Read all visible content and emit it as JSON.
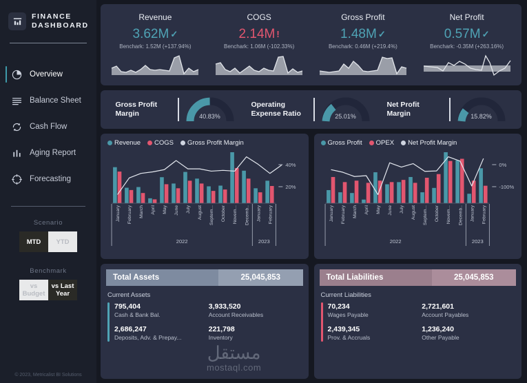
{
  "brand": {
    "line1": "FINANCE",
    "line2": "DASHBOARD",
    "logo_icon": "bar-chart-icon"
  },
  "sidebar": {
    "items": [
      {
        "label": "Overview",
        "icon": "pie-chart-icon",
        "active": true
      },
      {
        "label": "Balance Sheet",
        "icon": "list-lines-icon",
        "active": false
      },
      {
        "label": "Cash Flow",
        "icon": "refresh-icon",
        "active": false
      },
      {
        "label": "Aging Report",
        "icon": "bar-chart-icon",
        "active": false
      },
      {
        "label": "Forecasting",
        "icon": "target-icon",
        "active": false
      }
    ],
    "scenario": {
      "label": "Scenario",
      "options": [
        "MTD",
        "YTD"
      ],
      "selected": "MTD"
    },
    "benchmark": {
      "label": "Benchmark",
      "options": [
        "vs Budget",
        "vs Last Year"
      ],
      "selected": "vs Last Year"
    },
    "copyright": "© 2023, Metricalist BI Solutions"
  },
  "kpis": [
    {
      "title": "Revenue",
      "value": "3.62M",
      "flag": "✓",
      "color": "teal",
      "benchmark": "Benchark: 1.52M (+137.94%)"
    },
    {
      "title": "COGS",
      "value": "2.14M",
      "flag": "!",
      "color": "pink",
      "benchmark": "Benchark: 1.06M (-102.33%)"
    },
    {
      "title": "Gross Profit",
      "value": "1.48M",
      "flag": "✓",
      "color": "teal",
      "benchmark": "Benchark: 0.46M (+219.4%)"
    },
    {
      "title": "Net Profit",
      "value": "0.57M",
      "flag": "✓",
      "color": "teal",
      "benchmark": "Benchark: -0.35M (+263.16%)"
    }
  ],
  "gauges": [
    {
      "name": "Gross Profit Margin",
      "value": "40.83%",
      "pct": 40.83
    },
    {
      "name": "Operating Expense Ratio",
      "value": "25.01%",
      "pct": 25.01
    },
    {
      "name": "Net Profit Margin",
      "value": "15.82%",
      "pct": 15.82
    }
  ],
  "colors": {
    "teal": "#4a98a8",
    "pink": "#e2566f",
    "line": "#e4e8ef",
    "panel": "#2b3044"
  },
  "chart_data": [
    {
      "type": "bar",
      "title": "",
      "categories": [
        "January",
        "February",
        "March",
        "April",
        "May",
        "June",
        "July",
        "August",
        "Septem...",
        "October",
        "Novem...",
        "Decemb..",
        "January",
        "February"
      ],
      "group_labels": [
        "2022",
        "2023"
      ],
      "group_spans": [
        12,
        2
      ],
      "series": [
        {
          "name": "Revenue",
          "type": "bar",
          "color": "#4a98a8",
          "values": [
            205,
            88,
            92,
            28,
            148,
            112,
            178,
            140,
            96,
            100,
            290,
            185,
            85,
            128
          ]
        },
        {
          "name": "COGS",
          "type": "bar",
          "color": "#e2566f",
          "values": [
            180,
            75,
            58,
            22,
            108,
            85,
            128,
            112,
            70,
            78,
            200,
            140,
            62,
            98
          ]
        },
        {
          "name": "Gross Profit Margin",
          "type": "line",
          "color": "#e4e8ef",
          "axis": "right",
          "values": [
            2,
            24,
            30,
            32,
            35,
            47,
            36,
            36,
            33,
            34,
            33,
            52,
            42,
            30,
            41
          ]
        }
      ],
      "right_axis_ticks": [
        "40%",
        "20%"
      ],
      "ylabel": "",
      "xlabel": "",
      "grid": false,
      "legend": "top-left"
    },
    {
      "type": "bar",
      "title": "",
      "categories": [
        "January",
        "February",
        "March",
        "April",
        "May",
        "June",
        "July",
        "August",
        "Septem...",
        "October",
        "Novem...",
        "Decemb..",
        "January",
        "February"
      ],
      "group_labels": [
        "2022",
        "2023"
      ],
      "group_spans": [
        12,
        2
      ],
      "series": [
        {
          "name": "Gross Profit",
          "type": "bar",
          "color": "#4a98a8",
          "values": [
            36,
            30,
            28,
            10,
            85,
            52,
            58,
            72,
            30,
            42,
            140,
            118,
            26,
            96
          ]
        },
        {
          "name": "OPEX",
          "type": "bar",
          "color": "#e2566f",
          "values": [
            72,
            58,
            62,
            56,
            62,
            58,
            64,
            56,
            70,
            80,
            116,
            122,
            62,
            48
          ]
        },
        {
          "name": "Net Profit Margin",
          "type": "line",
          "color": "#e4e8ef",
          "axis": "right",
          "values": [
            -42,
            -48,
            -58,
            -56,
            -100,
            -26,
            -36,
            -28,
            -46,
            -45,
            -12,
            -22,
            -80,
            -16
          ]
        }
      ],
      "right_axis_ticks": [
        "0%",
        "-100%"
      ],
      "ylabel": "",
      "xlabel": "",
      "grid": false,
      "legend": "top-left"
    }
  ],
  "balance": {
    "assets": {
      "header_title": "Total Assets",
      "header_value": "25,045,853",
      "section": "Current Assets",
      "items": [
        {
          "value": "795,404",
          "label": "Cash & Bank Bal."
        },
        {
          "value": "3,933,520",
          "label": "Account Receivables"
        },
        {
          "value": "2,686,247",
          "label": "Deposits, Adv. & Prepay..."
        },
        {
          "value": "221,798",
          "label": "Inventory"
        }
      ]
    },
    "liabilities": {
      "header_title": "Total Liabilities",
      "header_value": "25,045,853",
      "section": "Current Liabilities",
      "items": [
        {
          "value": "70,234",
          "label": "Wages Payable"
        },
        {
          "value": "2,721,601",
          "label": "Account Payables"
        },
        {
          "value": "2,439,345",
          "label": "Prov. & Accruals"
        },
        {
          "value": "1,236,240",
          "label": "Other Payable"
        }
      ]
    }
  },
  "watermark": {
    "arabic": "مستقل",
    "latin": "mostaql.com"
  },
  "sparklines": [
    [
      24,
      20,
      30,
      26,
      21,
      27,
      21,
      31,
      27,
      25,
      27,
      26,
      25,
      10,
      42,
      24,
      28,
      22
    ],
    [
      18,
      28,
      34,
      28,
      31,
      24,
      30,
      25,
      27,
      22,
      30,
      27,
      28,
      12,
      38,
      30,
      26,
      24
    ],
    [
      30,
      29,
      32,
      28,
      22,
      29,
      17,
      26,
      15,
      24,
      27,
      23,
      28,
      8,
      10,
      16,
      34,
      22
    ],
    [
      26,
      27,
      27,
      30,
      22,
      28,
      16,
      24,
      17,
      23,
      28,
      30,
      10,
      34,
      28,
      36,
      30,
      18
    ]
  ]
}
